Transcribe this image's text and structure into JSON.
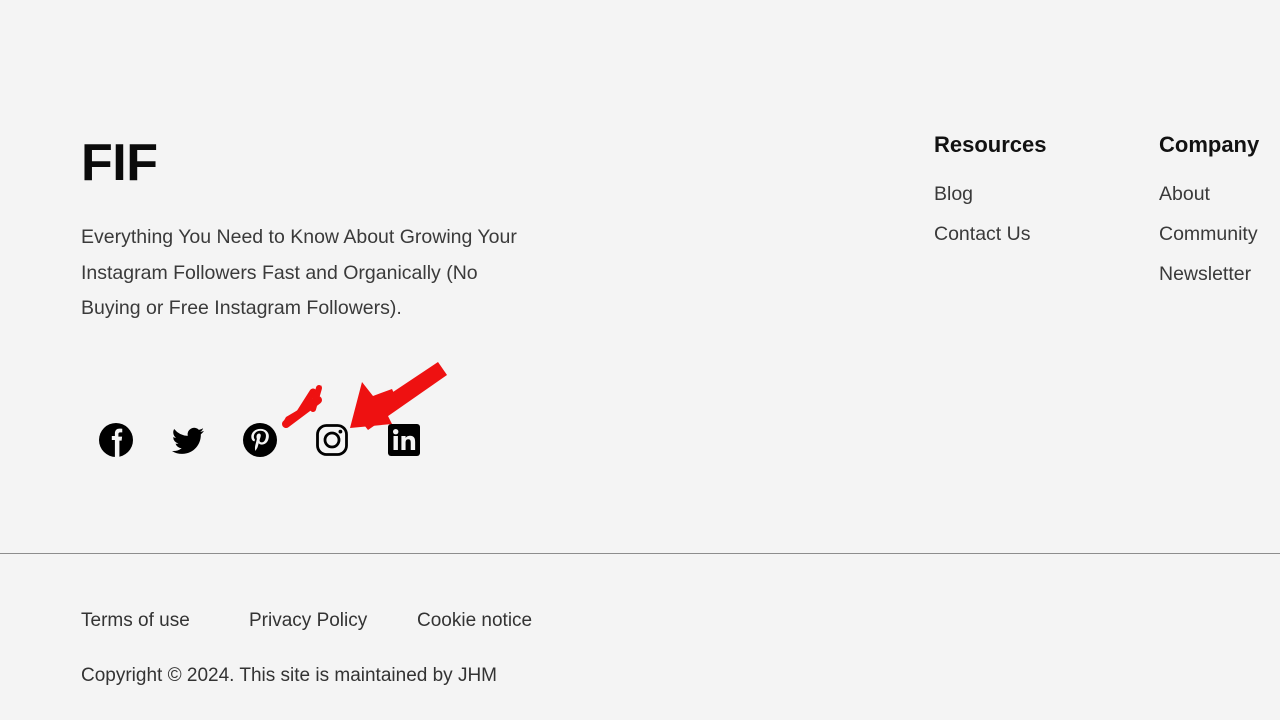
{
  "page": {
    "background_color": "#f4f4f4",
    "text_color": "#333333",
    "annotation_color": "#ee1111"
  },
  "brand": {
    "logo": "FIF",
    "tagline": "Everything You Need to Know About Growing Your Instagram Followers Fast and Organically (No Buying or Free Instagram Followers)."
  },
  "social": {
    "items": [
      {
        "name": "facebook",
        "label": "Facebook"
      },
      {
        "name": "twitter",
        "label": "Twitter"
      },
      {
        "name": "pinterest",
        "label": "Pinterest"
      },
      {
        "name": "instagram",
        "label": "Instagram"
      },
      {
        "name": "linkedin",
        "label": "LinkedIn"
      }
    ]
  },
  "columns": [
    {
      "heading": "Resources",
      "links": [
        {
          "label": "Blog"
        },
        {
          "label": "Contact Us"
        }
      ]
    },
    {
      "heading": "Company",
      "links": [
        {
          "label": "About"
        },
        {
          "label": "Community"
        },
        {
          "label": "Newsletter"
        }
      ]
    }
  ],
  "legal": {
    "links": [
      {
        "label": "Terms of use"
      },
      {
        "label": "Privacy Policy"
      },
      {
        "label": "Cookie notice"
      }
    ],
    "copyright": "Copyright © 2024. This site is maintained by JHM"
  },
  "annotation": {
    "type": "arrow-with-emphasis-lines",
    "color": "#ee1111",
    "points_at": "instagram"
  }
}
